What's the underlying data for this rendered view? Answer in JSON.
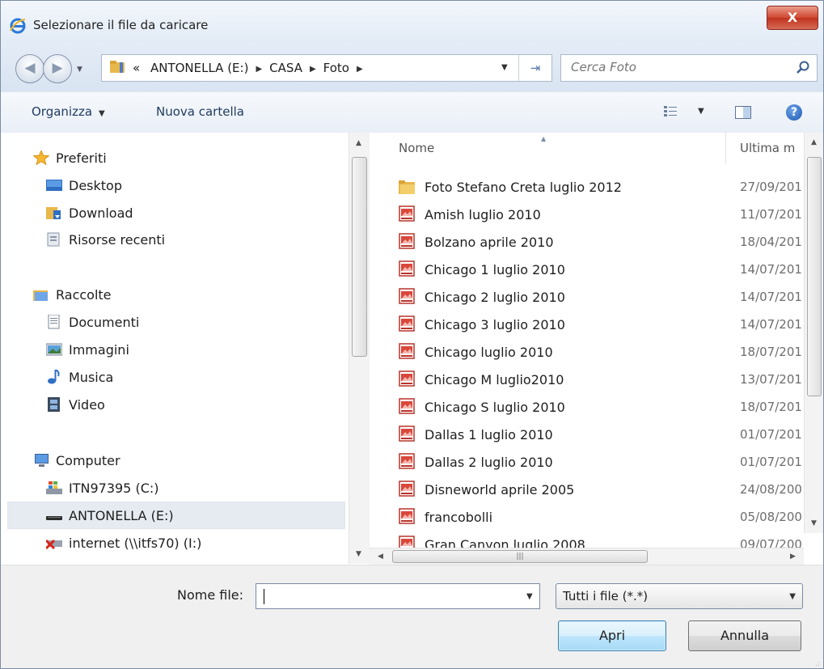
{
  "window": {
    "title": "Selezionare il file da caricare",
    "close_label": "X"
  },
  "navigation": {
    "breadcrumb": [
      "«",
      "ANTONELLA (E:)",
      "CASA",
      "Foto"
    ],
    "search_placeholder": "Cerca Foto"
  },
  "toolbar": {
    "organize_label": "Organizza",
    "new_folder_label": "Nuova cartella",
    "help_label": "?"
  },
  "sidebar": {
    "items": [
      {
        "label": "Preferiti",
        "icon": "star-icon"
      },
      {
        "label": "Desktop",
        "icon": "desktop-icon"
      },
      {
        "label": "Download",
        "icon": "download-folder-icon"
      },
      {
        "label": "Risorse recenti",
        "icon": "recent-places-icon"
      },
      {
        "label": "Raccolte",
        "icon": "libraries-icon"
      },
      {
        "label": "Documenti",
        "icon": "document-icon"
      },
      {
        "label": "Immagini",
        "icon": "pictures-icon"
      },
      {
        "label": "Musica",
        "icon": "music-note-icon"
      },
      {
        "label": "Video",
        "icon": "video-film-icon"
      },
      {
        "label": "Computer",
        "icon": "computer-icon"
      },
      {
        "label": "ITN97395 (C:)",
        "icon": "windows-drive-icon"
      },
      {
        "label": "ANTONELLA (E:)",
        "icon": "removable-drive-icon"
      },
      {
        "label": "internet (\\\\itfs70) (I:)",
        "icon": "disconnected-network-drive-icon"
      }
    ]
  },
  "file_list": {
    "columns": {
      "name": "Nome",
      "date": "Ultima m"
    },
    "rows": [
      {
        "name": "Foto Stefano Creta luglio 2012",
        "date": "27/09/201",
        "type": "folder"
      },
      {
        "name": "Amish luglio 2010",
        "date": "11/07/201",
        "type": "slideshow"
      },
      {
        "name": "Bolzano aprile 2010",
        "date": "18/04/201",
        "type": "slideshow"
      },
      {
        "name": "Chicago 1 luglio 2010",
        "date": "14/07/201",
        "type": "slideshow"
      },
      {
        "name": "Chicago 2 luglio 2010",
        "date": "14/07/201",
        "type": "slideshow"
      },
      {
        "name": "Chicago 3 luglio 2010",
        "date": "14/07/201",
        "type": "slideshow"
      },
      {
        "name": "Chicago luglio 2010",
        "date": "18/07/201",
        "type": "slideshow"
      },
      {
        "name": "Chicago M luglio2010",
        "date": "13/07/201",
        "type": "slideshow"
      },
      {
        "name": "Chicago S luglio 2010",
        "date": "18/07/201",
        "type": "slideshow"
      },
      {
        "name": "Dallas 1 luglio 2010",
        "date": "01/07/201",
        "type": "slideshow"
      },
      {
        "name": "Dallas 2 luglio 2010",
        "date": "01/07/201",
        "type": "slideshow"
      },
      {
        "name": "Disneworld aprile 2005",
        "date": "24/08/200",
        "type": "slideshow"
      },
      {
        "name": "francobolli",
        "date": "05/08/200",
        "type": "slideshow"
      },
      {
        "name": "Gran Canyon luglio 2008",
        "date": "09/07/200",
        "type": "slideshow"
      }
    ]
  },
  "bottom": {
    "filename_label": "Nome file:",
    "filename_value": "",
    "filetype_value": "Tutti i file (*.*)",
    "open_label": "Apri",
    "cancel_label": "Annulla"
  },
  "colors": {
    "title_bar": "#e2ebf6",
    "close_button": "#c74430",
    "selected_row": "#e6ebf2",
    "open_button": "#bee6fd"
  }
}
